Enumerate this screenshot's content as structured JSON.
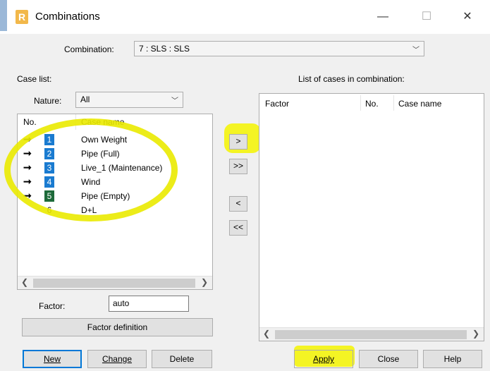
{
  "window": {
    "app_icon_letter": "R",
    "title": "Combinations",
    "minimize_glyph": "—",
    "maximize_glyph": "☐",
    "close_glyph": "✕"
  },
  "combination": {
    "label": "Combination:",
    "value": "7 : SLS : SLS"
  },
  "case_list": {
    "label": "Case list:",
    "nature_label": "Nature:",
    "nature_value": "All",
    "headers": {
      "no": "No.",
      "case_name": "Case name"
    },
    "rows": [
      {
        "arrow": "➞",
        "no": "1",
        "name": "Own Weight"
      },
      {
        "arrow": "➞",
        "no": "2",
        "name": "Pipe (Full)"
      },
      {
        "arrow": "➞",
        "no": "3",
        "name": "Live_1 (Maintenance)"
      },
      {
        "arrow": "➞",
        "no": "4",
        "name": "Wind"
      },
      {
        "arrow": "➞",
        "no": "5",
        "name": "Pipe (Empty)"
      },
      {
        "arrow": "",
        "no": "6",
        "name": "D+L"
      }
    ]
  },
  "factor": {
    "label": "Factor:",
    "value": "auto",
    "definition_button": "Factor definition"
  },
  "transfer": {
    "add": ">",
    "add_all": ">>",
    "remove": "<",
    "remove_all": "<<"
  },
  "combination_cases": {
    "label": "List of cases in combination:",
    "headers": {
      "factor": "Factor",
      "no": "No.",
      "case_name": "Case name"
    }
  },
  "scroll": {
    "left": "❮",
    "right": "❯"
  },
  "buttons": {
    "new": "New",
    "change": "Change",
    "delete": "Delete",
    "apply": "Apply",
    "close": "Close",
    "help": "Help"
  },
  "highlight_color": "#f5f500",
  "selection_color": "#1a7bd0"
}
